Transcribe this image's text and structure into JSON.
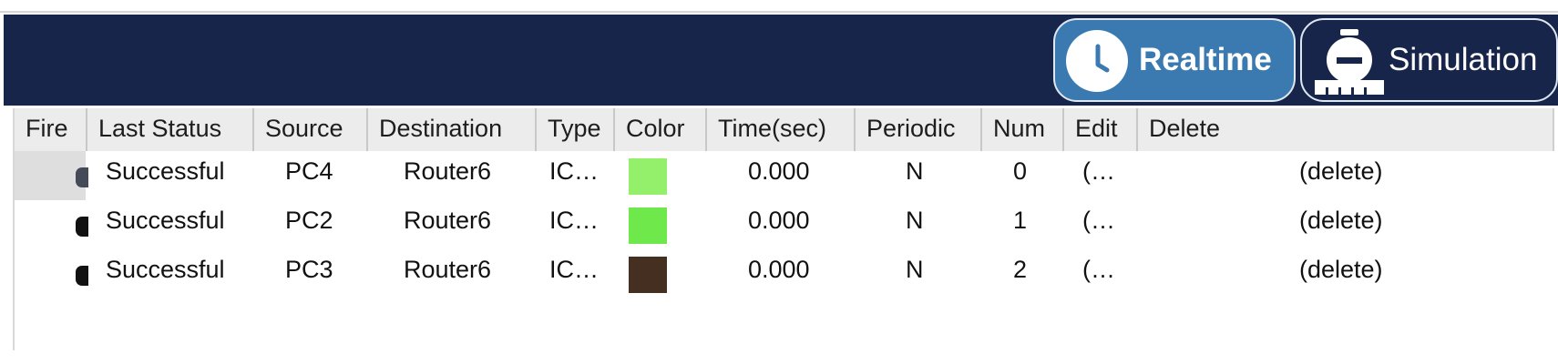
{
  "toolbar": {
    "realtime_label": "Realtime",
    "simulation_label": "Simulation",
    "active_mode": "Realtime",
    "colors": {
      "bar": "#17254a",
      "active": "#3a7ab0"
    }
  },
  "table": {
    "columns": [
      "Fire",
      "Last Status",
      "Source",
      "Destination",
      "Type",
      "Color",
      "Time(sec)",
      "Periodic",
      "Num",
      "Edit",
      "Delete"
    ],
    "rows": [
      {
        "last_status": "Successful",
        "source": "PC4",
        "destination": "Router6",
        "type": "IC…",
        "color": "#94ef6a",
        "time": "0.000",
        "periodic": "N",
        "num": "0",
        "edit": "(…",
        "delete": "(delete)"
      },
      {
        "last_status": "Successful",
        "source": "PC2",
        "destination": "Router6",
        "type": "IC…",
        "color": "#6ee84a",
        "time": "0.000",
        "periodic": "N",
        "num": "1",
        "edit": "(…",
        "delete": "(delete)"
      },
      {
        "last_status": "Successful",
        "source": "PC3",
        "destination": "Router6",
        "type": "IC…",
        "color": "#452f20",
        "time": "0.000",
        "periodic": "N",
        "num": "2",
        "edit": "(…",
        "delete": "(delete)"
      }
    ]
  }
}
